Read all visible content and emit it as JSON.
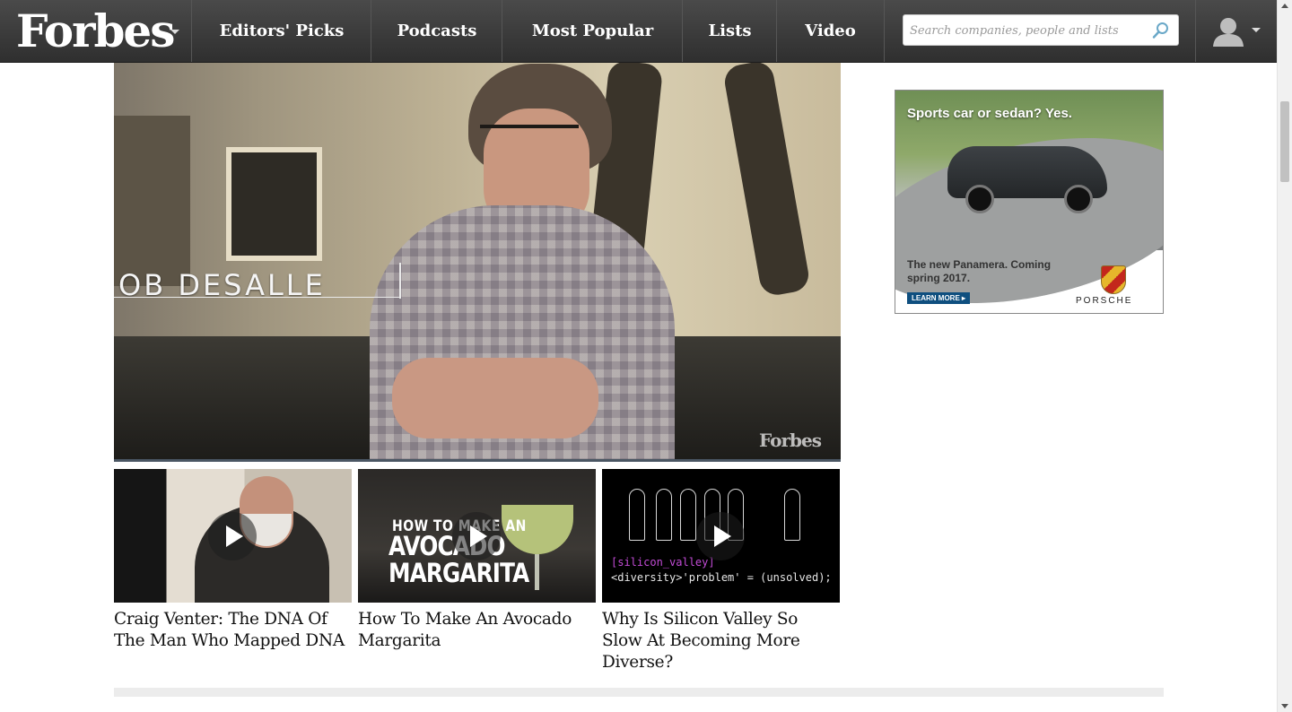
{
  "header": {
    "logo": "Forbes",
    "nav": [
      "Editors' Picks",
      "Podcasts",
      "Most Popular",
      "Lists",
      "Video"
    ],
    "search_placeholder": "Search companies, people and lists"
  },
  "video": {
    "lower_third": "OB DESALLE",
    "watermark": "Forbes"
  },
  "related_videos": [
    {
      "title": "Craig Venter: The DNA Of The Man Who Mapped DNA",
      "overlay": ""
    },
    {
      "title": "How To Make An Avocado Margarita",
      "overlay_a": "HOW TO MAKE AN",
      "overlay_b": "AVOCADO MARGARITA"
    },
    {
      "title": "Why Is Silicon Valley So Slow At Becoming More Diverse?",
      "code_1": "[silicon_valley]",
      "code_2": "<diversity>'problem' = (unsolved);"
    }
  ],
  "ad": {
    "headline": "Sports car or sedan?  Yes.",
    "copy": "The new Panamera. Coming spring 2017.",
    "cta": "LEARN MORE ▸",
    "brand": "PORSCHE"
  },
  "colors": {
    "nav_bg": "#3c3c3c",
    "search_icon": "#6aa8c8",
    "ad_cta": "#0f4f7f"
  },
  "icons": {
    "search": "search-icon",
    "user": "user-avatar-icon",
    "play": "play-icon"
  }
}
